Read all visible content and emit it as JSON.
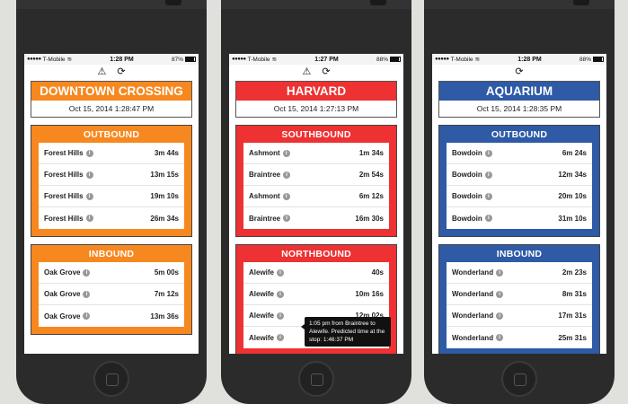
{
  "colors": {
    "orange": "#f7881f",
    "red": "#ee3132",
    "blue": "#2e5aa6"
  },
  "icons": {
    "alert": "warning-triangle-icon",
    "refresh": "refresh-icon",
    "info": "info-icon"
  },
  "phones": [
    {
      "status": {
        "carrier": "T-Mobile",
        "time": "1:28 PM",
        "battery": "87%"
      },
      "station": {
        "name": "DOWNTOWN CROSSING",
        "date": "Oct 15, 2014 1:28:47 PM"
      },
      "directions": [
        {
          "title": "OUTBOUND",
          "rows": [
            {
              "dest": "Forest Hills",
              "time": "3m 44s"
            },
            {
              "dest": "Forest Hills",
              "time": "13m 15s"
            },
            {
              "dest": "Forest Hills",
              "time": "19m 10s"
            },
            {
              "dest": "Forest Hills",
              "time": "26m 34s"
            }
          ]
        },
        {
          "title": "INBOUND",
          "rows": [
            {
              "dest": "Oak Grove",
              "time": "5m 00s"
            },
            {
              "dest": "Oak Grove",
              "time": "7m 12s"
            },
            {
              "dest": "Oak Grove",
              "time": "13m 36s"
            }
          ]
        }
      ]
    },
    {
      "status": {
        "carrier": "T-Mobile",
        "time": "1:27 PM",
        "battery": "88%"
      },
      "station": {
        "name": "HARVARD",
        "date": "Oct 15, 2014 1:27:13 PM"
      },
      "directions": [
        {
          "title": "SOUTHBOUND",
          "rows": [
            {
              "dest": "Ashmont",
              "time": "1m 34s"
            },
            {
              "dest": "Braintree",
              "time": "2m 54s"
            },
            {
              "dest": "Ashmont",
              "time": "6m 12s"
            },
            {
              "dest": "Braintree",
              "time": "16m 30s"
            }
          ]
        },
        {
          "title": "NORTHBOUND",
          "rows": [
            {
              "dest": "Alewife",
              "time": "40s"
            },
            {
              "dest": "Alewife",
              "time": "10m 16s"
            },
            {
              "dest": "Alewife",
              "time": "12m 02s"
            },
            {
              "dest": "Alewife",
              "time": ""
            }
          ]
        }
      ],
      "tooltip": "1:05 pm from Braintree to Alewife. Predicted time at the stop: 1:46:37 PM"
    },
    {
      "status": {
        "carrier": "T-Mobile",
        "time": "1:28 PM",
        "battery": "88%"
      },
      "station": {
        "name": "AQUARIUM",
        "date": "Oct 15, 2014 1:28:35 PM"
      },
      "directions": [
        {
          "title": "OUTBOUND",
          "rows": [
            {
              "dest": "Bowdoin",
              "time": "6m 24s"
            },
            {
              "dest": "Bowdoin",
              "time": "12m 34s"
            },
            {
              "dest": "Bowdoin",
              "time": "20m 10s"
            },
            {
              "dest": "Bowdoin",
              "time": "31m 10s"
            }
          ]
        },
        {
          "title": "INBOUND",
          "rows": [
            {
              "dest": "Wonderland",
              "time": "2m 23s"
            },
            {
              "dest": "Wonderland",
              "time": "8m 31s"
            },
            {
              "dest": "Wonderland",
              "time": "17m 31s"
            },
            {
              "dest": "Wonderland",
              "time": "25m 31s"
            }
          ]
        }
      ]
    }
  ]
}
